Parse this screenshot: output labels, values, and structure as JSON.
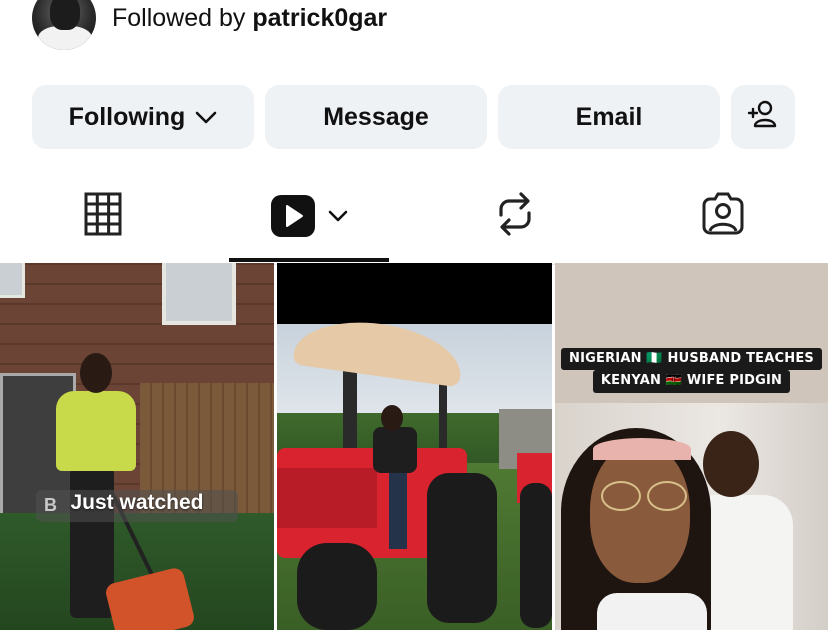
{
  "profile": {
    "followed_by_prefix": "Followed by",
    "followed_by_user": "patrick0gar"
  },
  "actions": {
    "following_label": "Following",
    "message_label": "Message",
    "email_label": "Email"
  },
  "tabs": [
    {
      "name": "grid",
      "icon": "grid-icon"
    },
    {
      "name": "reels",
      "icon": "reels-icon",
      "active": true
    },
    {
      "name": "reposts",
      "icon": "repost-icon"
    },
    {
      "name": "tagged",
      "icon": "tagged-icon"
    }
  ],
  "posts": [
    {
      "overlay_label": "Just watched",
      "partial_caption": "B"
    },
    {},
    {
      "caption_line1": "NIGERIAN 🇳🇬 HUSBAND TEACHES",
      "caption_line2": "KENYAN 🇰🇪 WIFE PIDGIN"
    }
  ],
  "colors": {
    "button_bg": "#eff2f5",
    "text": "#111111",
    "active_tab_underline": "#111111"
  }
}
